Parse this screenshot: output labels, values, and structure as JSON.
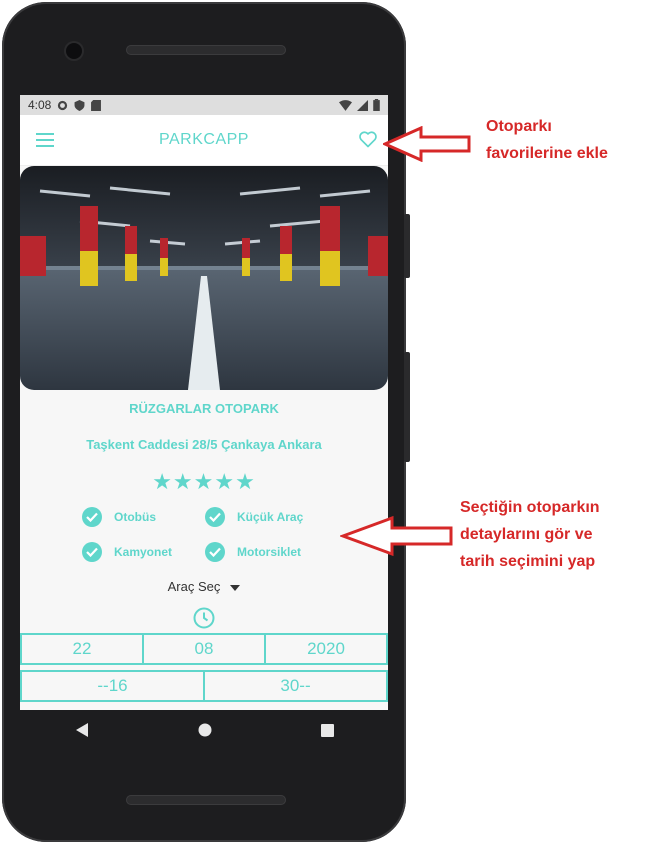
{
  "status_bar": {
    "time": "4:08"
  },
  "app": {
    "title": "PARKCAPP"
  },
  "parking": {
    "name": "RÜZGARLAR OTOPARK",
    "address": "Taşkent Caddesi 28/5 Çankaya Ankara",
    "rating": 5,
    "stars_text": "★★★★★"
  },
  "features": [
    {
      "label": "Otobüs"
    },
    {
      "label": "Küçük Araç"
    },
    {
      "label": "Kamyonet"
    },
    {
      "label": "Motorsiklet"
    }
  ],
  "vehicle_select": {
    "label": "Araç Seç"
  },
  "date": {
    "day": "22",
    "month": "08",
    "year": "2020"
  },
  "time": {
    "start": "--16",
    "end": "30--"
  },
  "annotations": {
    "top": [
      "Otoparkı",
      "favorilerine ekle"
    ],
    "middle": [
      "Seçtiğin otoparkın",
      "detaylarını gör ve",
      "tarih seçimini yap"
    ]
  },
  "colors": {
    "accent": "#5fd6cb",
    "annotation": "#d62828"
  },
  "icons": [
    "menu-icon",
    "heart-icon",
    "check-icon",
    "clock-icon",
    "dropdown-caret-icon",
    "back-icon",
    "home-icon",
    "recents-icon"
  ]
}
